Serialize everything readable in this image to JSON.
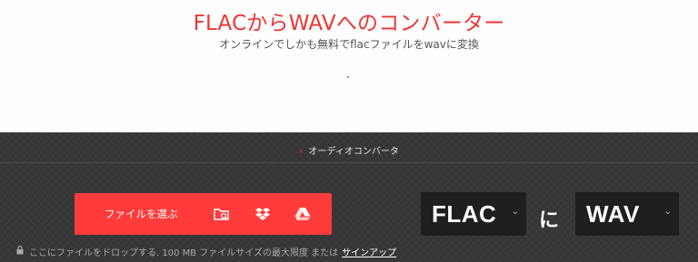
{
  "header": {
    "title": "FLACからWAVへのコンバーター",
    "subtitle": "オンラインでしかも無料でflacファイルをwavに変換"
  },
  "breadcrumb": {
    "label": "オーディオコンバータ"
  },
  "uploader": {
    "choose_label": "ファイルを選ぶ",
    "icons": [
      "folder-search-icon",
      "dropbox-icon",
      "google-drive-icon"
    ]
  },
  "converter": {
    "from": "FLAC",
    "joiner": "に",
    "to": "WAV"
  },
  "footer": {
    "drop_text": "ここにファイルをドロップする. 100 MB ファイルサイズの最大限度 または",
    "signup_label": "サインアップ"
  },
  "colors": {
    "accent": "#ff3b3b",
    "title_red": "#ed3535",
    "dark_bg": "#3a3a3a",
    "select_bg": "#1f1f1f"
  }
}
